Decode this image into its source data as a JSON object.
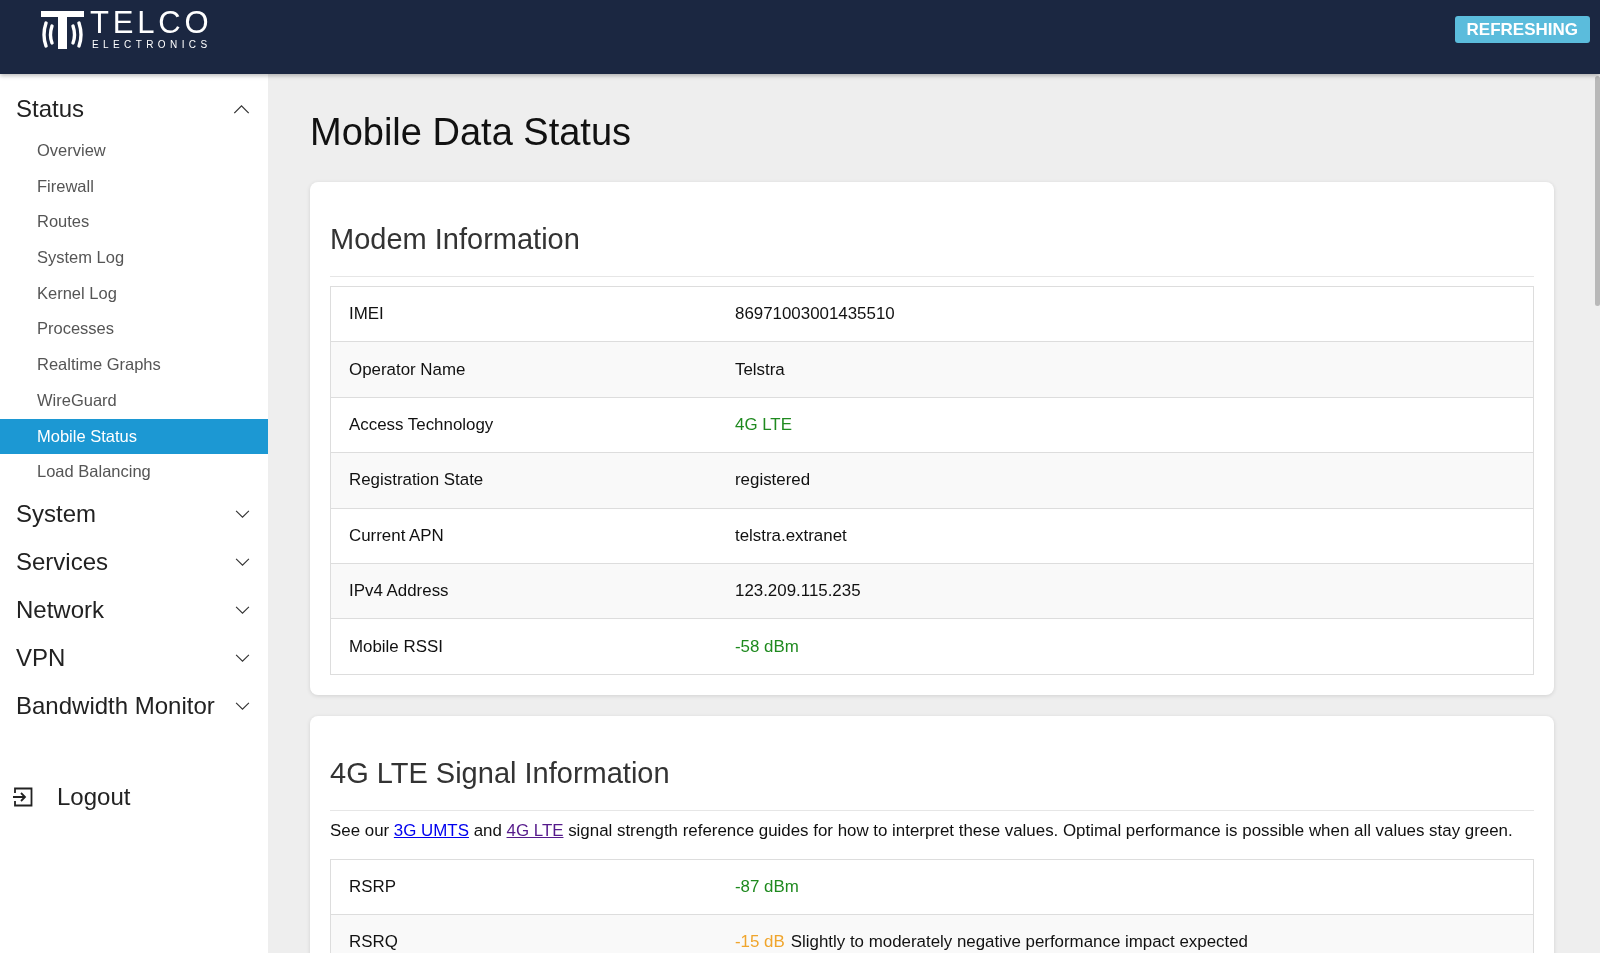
{
  "header": {
    "brand": {
      "name": "TELCO",
      "tagline": "ELECTRONICS"
    },
    "refresh_indicator": "REFRESHING"
  },
  "sidebar": {
    "sections": [
      {
        "label": "Status",
        "expanded": true,
        "items": [
          {
            "label": "Overview",
            "selected": false
          },
          {
            "label": "Firewall",
            "selected": false
          },
          {
            "label": "Routes",
            "selected": false
          },
          {
            "label": "System Log",
            "selected": false
          },
          {
            "label": "Kernel Log",
            "selected": false
          },
          {
            "label": "Processes",
            "selected": false
          },
          {
            "label": "Realtime Graphs",
            "selected": false
          },
          {
            "label": "WireGuard",
            "selected": false
          },
          {
            "label": "Mobile Status",
            "selected": true
          },
          {
            "label": "Load Balancing",
            "selected": false
          }
        ]
      },
      {
        "label": "System",
        "expanded": false
      },
      {
        "label": "Services",
        "expanded": false
      },
      {
        "label": "Network",
        "expanded": false
      },
      {
        "label": "VPN",
        "expanded": false
      },
      {
        "label": "Bandwidth Monitor",
        "expanded": false
      }
    ],
    "logout": "Logout"
  },
  "page": {
    "title": "Mobile Data Status"
  },
  "cards": [
    {
      "title": "Modem Information",
      "rows": [
        {
          "label": "IMEI",
          "value": "86971003001435510",
          "color": "#111111"
        },
        {
          "label": "Operator Name",
          "value": "Telstra",
          "color": "#111111"
        },
        {
          "label": "Access Technology",
          "value": "4G LTE",
          "color": "#1f8a1f"
        },
        {
          "label": "Registration State",
          "value": "registered",
          "color": "#111111"
        },
        {
          "label": "Current APN",
          "value": "telstra.extranet",
          "color": "#111111"
        },
        {
          "label": "IPv4 Address",
          "value": "123.209.115.235",
          "color": "#111111"
        },
        {
          "label": "Mobile RSSI",
          "value": "-58 dBm",
          "color": "#1f8a1f"
        }
      ]
    },
    {
      "title": "4G LTE Signal Information",
      "intro": [
        {
          "kind": "text",
          "text": "See our "
        },
        {
          "kind": "link",
          "text": "3G UMTS",
          "visited": false
        },
        {
          "kind": "text",
          "text": " and "
        },
        {
          "kind": "link",
          "text": "4G LTE",
          "visited": true
        },
        {
          "kind": "text",
          "text": " signal strength reference guides for how to interpret these values. Optimal performance is possible when all values stay green."
        }
      ],
      "rows": [
        {
          "label": "RSRP",
          "value": "-87 dBm",
          "color": "#1f8a1f"
        },
        {
          "label": "RSRQ",
          "value": "-15 dB",
          "color": "#f0a52c",
          "note": "Slightly to moderately negative performance impact expected"
        }
      ]
    }
  ]
}
